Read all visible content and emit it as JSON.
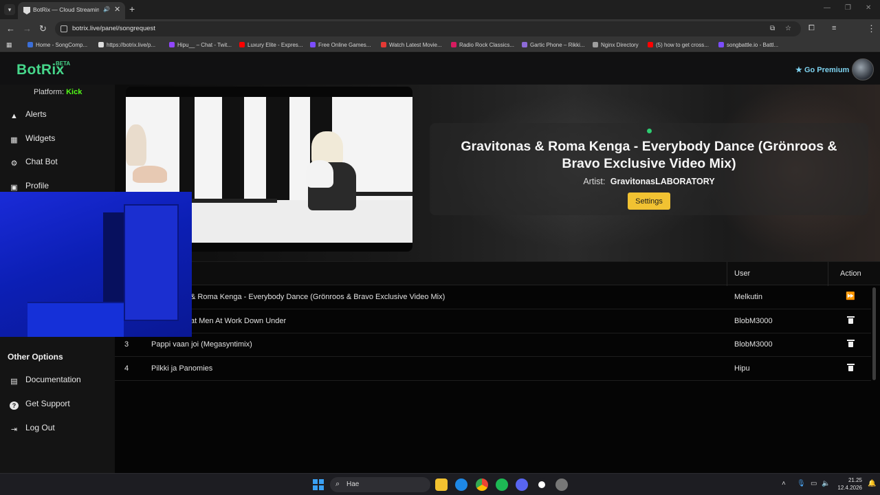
{
  "browser": {
    "tab_title": "BotRix — Cloud Streaming I",
    "url": "botrix.live/panel/songrequest",
    "bookmarks": [
      {
        "label": "Home - SongComp...",
        "color": "#3b6fd8"
      },
      {
        "label": "https://botrix.live/p...",
        "color": "#dddddd"
      },
      {
        "label": "Hipu__ – Chat - Twit...",
        "color": "#9146ff"
      },
      {
        "label": "Luxury Elite - Expres...",
        "color": "#ff0000"
      },
      {
        "label": "Free Online Games...",
        "color": "#7c4dff"
      },
      {
        "label": "Watch Latest Movie...",
        "color": "#e53935"
      },
      {
        "label": "Radio Rock Classics...",
        "color": "#d81b60"
      },
      {
        "label": "Gartic Phone – Rikki...",
        "color": "#8e6bd8"
      },
      {
        "label": "Nginx Directory",
        "color": "#9e9e9e"
      },
      {
        "label": "(5) how to get cross...",
        "color": "#ff0000"
      },
      {
        "label": "songbattle.io - Battl...",
        "color": "#7c4dff"
      }
    ]
  },
  "header": {
    "logo": "BotRix",
    "logo_badge": "BETA",
    "premium_label": "Go Premium"
  },
  "sidebar": {
    "platform_label": "Platform:",
    "platform_value": "Kick",
    "items": [
      {
        "label": "Alerts",
        "icon": "warning-icon"
      },
      {
        "label": "Widgets",
        "icon": "grid-icon"
      },
      {
        "label": "Chat Bot",
        "icon": "robot-icon"
      },
      {
        "label": "Profile",
        "icon": "profile-icon"
      }
    ],
    "other_title": "Other Options",
    "other_items": [
      {
        "label": "Documentation",
        "icon": "book-icon"
      },
      {
        "label": "Get Support",
        "icon": "help-icon"
      },
      {
        "label": "Log Out",
        "icon": "logout-icon"
      }
    ]
  },
  "now_playing": {
    "title": "Gravitonas & Roma Kenga - Everybody Dance (Grönroos & Bravo Exclusive Video Mix)",
    "artist_label": "Artist:",
    "artist": "GravitonasLABORATORY",
    "settings_label": "Settings"
  },
  "queue": {
    "columns": {
      "user": "User",
      "action": "Action"
    },
    "rows": [
      {
        "num": "",
        "title": "& Roma Kenga - Everybody Dance (Grönroos & Bravo Exclusive Video Mix)",
        "user": "Melkutin",
        "action": "skip"
      },
      {
        "num": "",
        "title": "at Men At Work Down Under",
        "user": "BlobM3000",
        "action": "delete"
      },
      {
        "num": "3",
        "title": "Pappi vaan joi (Megasyntimix)",
        "user": "BlobM3000",
        "action": "delete"
      },
      {
        "num": "4",
        "title": "Pilkki ja Panomies",
        "user": "Hipu",
        "action": "delete"
      }
    ]
  },
  "taskbar": {
    "search_placeholder": "Hae",
    "time": "21.25",
    "date": "12.4.2026"
  }
}
